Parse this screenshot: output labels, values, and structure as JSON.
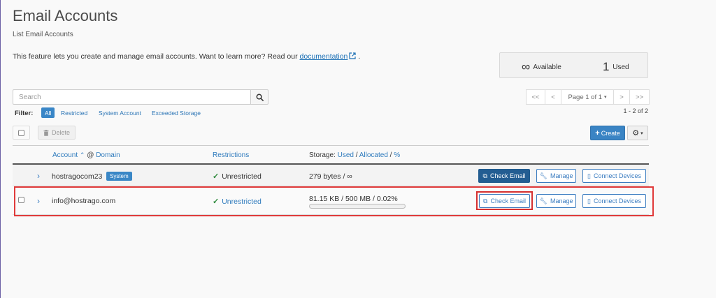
{
  "page": {
    "title": "Email Accounts",
    "subtitle": "List Email Accounts",
    "intro_text": "This feature lets you create and manage email accounts. Want to learn more? Read our",
    "intro_link": "documentation",
    "intro_end": "."
  },
  "stats": {
    "available_value": "∞",
    "available_label": "Available",
    "used_value": "1",
    "used_label": "Used"
  },
  "search": {
    "placeholder": "Search"
  },
  "pagination": {
    "first": "<<",
    "prev": "<",
    "page_label": "Page 1 of 1",
    "next": ">",
    "last": ">>",
    "range": "1 - 2 of 2"
  },
  "filter": {
    "label": "Filter:",
    "options": [
      "All",
      "Restricted",
      "System Account",
      "Exceeded Storage"
    ],
    "active": "All"
  },
  "toolbar": {
    "delete_label": "Delete",
    "create_label": "Create"
  },
  "table": {
    "headers": {
      "account": "Account",
      "at": "@",
      "domain": "Domain",
      "restrictions": "Restrictions",
      "storage": "Storage:",
      "used": "Used",
      "sep1": "/",
      "allocated": "Allocated",
      "sep2": "/",
      "percent": "%"
    },
    "rows": [
      {
        "account": "hostragocom23",
        "badge": "System",
        "restriction": "Unrestricted",
        "storage": "279 bytes / ∞",
        "actions": [
          "Check Email",
          "Manage",
          "Connect Devices"
        ]
      },
      {
        "account": "info@hostrago.com",
        "restriction": "Unrestricted",
        "storage": "81.15 KB / 500 MB / 0.02%",
        "usage_fraction": 0.0002,
        "actions": [
          "Check Email",
          "Manage",
          "Connect Devices"
        ]
      }
    ]
  },
  "colors": {
    "accent": "#3a84c4",
    "highlight": "#e03a3a",
    "success": "#2f8a3d"
  }
}
